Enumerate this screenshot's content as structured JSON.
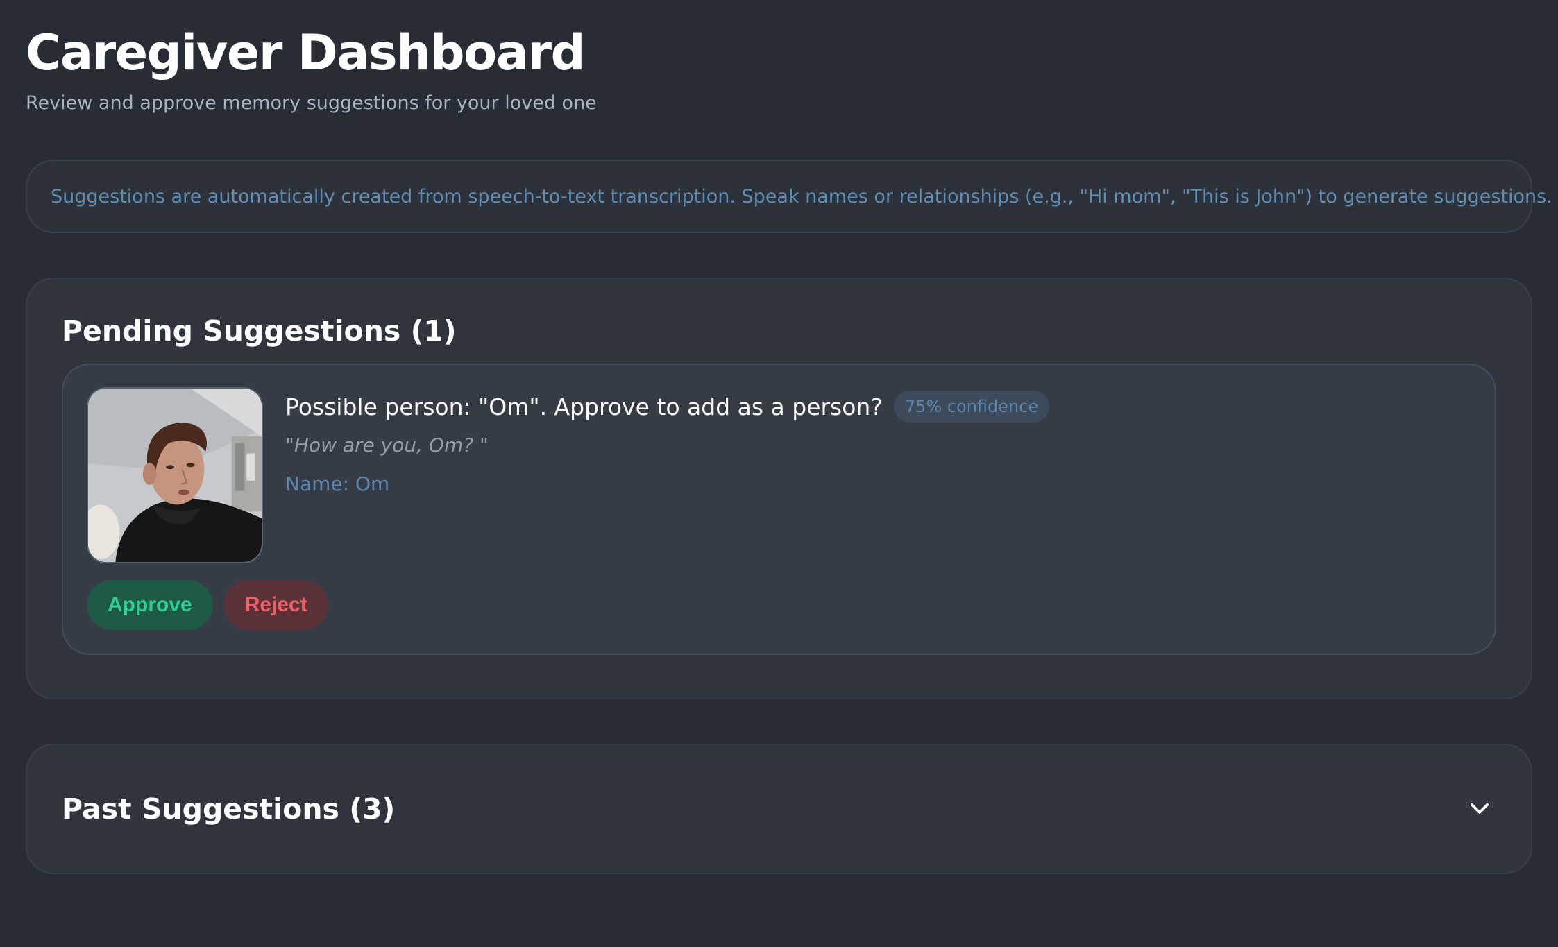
{
  "header": {
    "title": "Caregiver Dashboard",
    "subtitle": "Review and approve memory suggestions for your loved one"
  },
  "info_banner": {
    "text": "Suggestions are automatically created from speech-to-text transcription. Speak names or relationships (e.g., \"Hi mom\", \"This is John\") to generate suggestions."
  },
  "pending": {
    "heading": "Pending Suggestions (1)",
    "items": [
      {
        "question": "Possible person: \"Om\". Approve to add as a person?",
        "confidence": "75% confidence",
        "quote": "\"How are you, Om? \"",
        "name": "Name: Om",
        "approve_label": "Approve",
        "reject_label": "Reject"
      }
    ]
  },
  "past": {
    "heading": "Past Suggestions (3)",
    "toggle_icon": "chevron-down-icon"
  },
  "colors": {
    "background": "#282c34",
    "accent_blue": "#5b86ad",
    "approve_green": "#2ed08f",
    "reject_red": "#ef5f66"
  }
}
